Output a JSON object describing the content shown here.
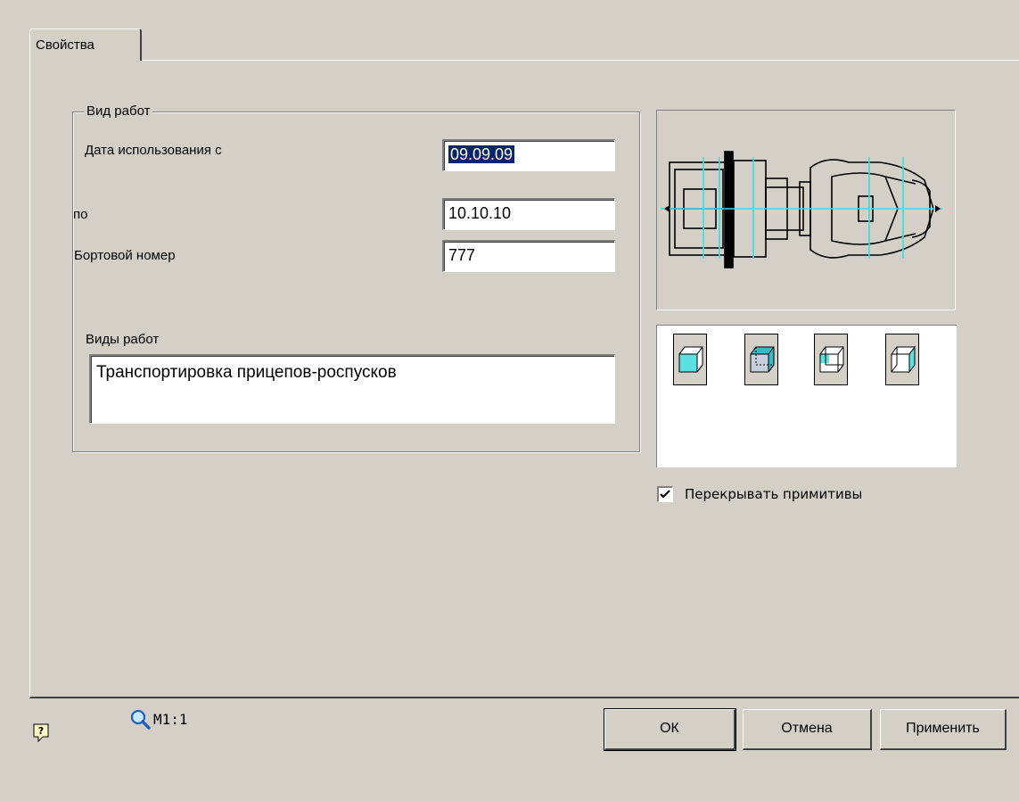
{
  "tabs": [
    {
      "label": "Свойства"
    }
  ],
  "group": {
    "title": "Вид работ",
    "date_from_label": "Дата использования с",
    "date_from_value": "09.09.09",
    "date_to_label": "по",
    "date_to_value": "10.10.10",
    "board_label": "Бортовой номер",
    "board_value": "777",
    "work_types_label": "Виды работ",
    "work_types_value": "Транспортировка прицепов-роспусков"
  },
  "preview": {
    "icon": "truck-top-view-drawing"
  },
  "display_modes": [
    {
      "name": "solid-cube-icon"
    },
    {
      "name": "hatched-cube-icon"
    },
    {
      "name": "side-shaded-cube-icon"
    },
    {
      "name": "front-shaded-cube-icon"
    }
  ],
  "overlap_checkbox": {
    "label": "Перекрывать примитивы",
    "checked": true
  },
  "footer": {
    "help_icon": "help-icon",
    "zoom_icon": "magnifier-icon",
    "scale_label": "М1:1",
    "ok_label": "ОК",
    "cancel_label": "Отмена",
    "apply_label": "Применить"
  },
  "colors": {
    "accent_cyan": "#5ee0e0",
    "selection": "#0a246a",
    "face": "#d4d0c8"
  }
}
